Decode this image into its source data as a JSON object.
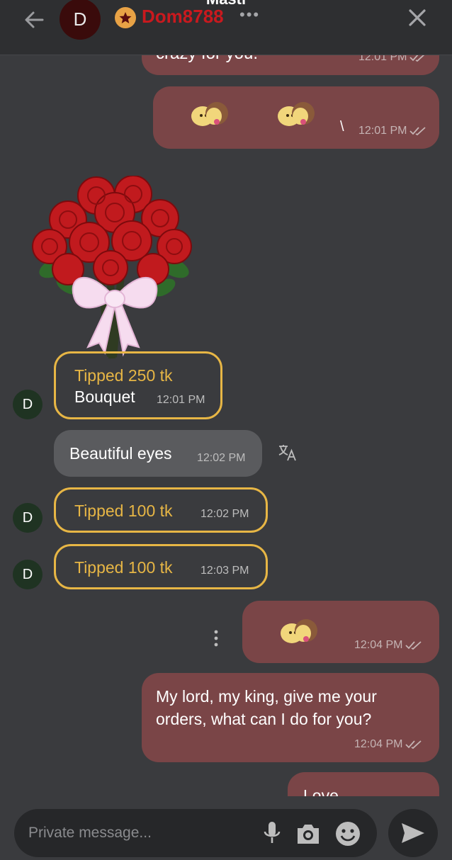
{
  "header": {
    "title": "Masti",
    "avatar_letter": "D",
    "username": "Dom8788",
    "more": "•••"
  },
  "messages": {
    "m1": {
      "text": "crazy for you.",
      "time": "12:01 PM"
    },
    "m2": {
      "cursor": "\\",
      "time": "12:01 PM"
    },
    "m3": {
      "tip": "Tipped 250 tk",
      "gift": "Bouquet",
      "time": "12:01 PM",
      "avatar": "D"
    },
    "m4": {
      "text": "Beautiful eyes",
      "time": "12:02 PM"
    },
    "m5": {
      "tip": "Tipped 100 tk",
      "time": "12:02 PM",
      "avatar": "D"
    },
    "m6": {
      "tip": "Tipped 100 tk",
      "time": "12:03 PM",
      "avatar": "D"
    },
    "m7": {
      "time": "12:04 PM"
    },
    "m8": {
      "line1": "My lord, my king, give me your",
      "line2": "orders, what can I do for you?",
      "time": "12:04 PM"
    },
    "m9": {
      "text": "Love"
    }
  },
  "composer": {
    "placeholder": "Private message..."
  },
  "icons": [
    "back-arrow-icon",
    "star-icon",
    "close-icon",
    "kiss-emoji-icon",
    "rose-bouquet-icon",
    "translate-icon",
    "vertical-more-icon",
    "microphone-icon",
    "camera-icon",
    "emoji-icon",
    "send-icon",
    "double-check-icon"
  ],
  "colors": {
    "tip_accent": "#e7b645",
    "outgoing_bubble": "#7a4547",
    "username": "#c9191e"
  }
}
